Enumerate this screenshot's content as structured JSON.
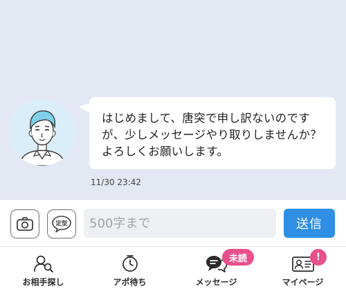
{
  "chat": {
    "message": {
      "text": "はじめまして、唐突で申し訳ないのです\nが、少しメッセージやり取りしませんか？\nよろしくお願いします。",
      "timestamp": "11/30 23:42",
      "avatar_icon": "user-avatar-illustration"
    }
  },
  "input_bar": {
    "camera_icon": "camera-icon",
    "template_label": "定型",
    "input_placeholder": "500字まで",
    "input_value": "",
    "send_label": "送信"
  },
  "tabs": [
    {
      "label": "お相手探し",
      "icon": "person-search-icon"
    },
    {
      "label": "アポ待ち",
      "icon": "clock-icon"
    },
    {
      "label": "メッセージ",
      "icon": "chat-bubbles-icon",
      "badge": "未読"
    },
    {
      "label": "マイページ",
      "icon": "id-card-icon",
      "badge": "!"
    }
  ],
  "colors": {
    "chat_background": "#e3e8f2",
    "accent": "#2e8fe4",
    "badge": "#e8508c"
  }
}
